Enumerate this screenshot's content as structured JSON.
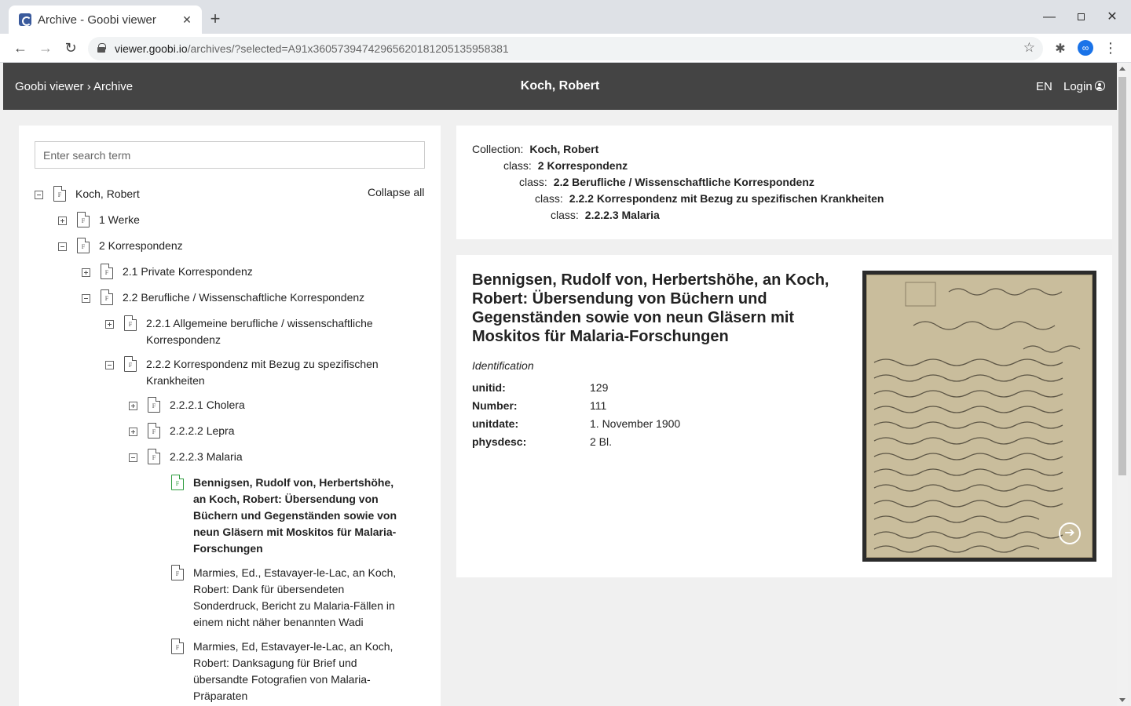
{
  "browser": {
    "tab_title": "Archive - Goobi viewer",
    "url_domain": "viewer.goobi.io",
    "url_path": "/archives/?selected=A91x36057394742965620181205135958381"
  },
  "header": {
    "breadcrumb": "Goobi viewer › Archive",
    "title": "Koch, Robert",
    "lang": "EN",
    "login": "Login"
  },
  "sidebar": {
    "search_placeholder": "Enter search term",
    "collapse_all": "Collapse all",
    "nodes": [
      {
        "label": "Koch, Robert",
        "toggle": "minus"
      },
      {
        "label": "1 Werke",
        "toggle": "plus"
      },
      {
        "label": "2 Korrespondenz",
        "toggle": "minus"
      },
      {
        "label": "2.1 Private Korrespondenz",
        "toggle": "plus"
      },
      {
        "label": "2.2 Berufliche / Wissenschaftliche Korrespondenz",
        "toggle": "minus"
      },
      {
        "label": "2.2.1 Allgemeine berufliche / wissenschaftliche Korrespondenz",
        "toggle": "plus"
      },
      {
        "label": "2.2.2 Korrespondenz mit Bezug zu spezifischen Krankheiten",
        "toggle": "minus"
      },
      {
        "label": "2.2.2.1 Cholera",
        "toggle": "plus"
      },
      {
        "label": "2.2.2.2 Lepra",
        "toggle": "plus"
      },
      {
        "label": "2.2.2.3 Malaria",
        "toggle": "minus"
      },
      {
        "label": "Bennigsen, Rudolf von, Herbertshöhe, an Koch, Robert: Übersendung von Büchern und Gegenständen sowie von neun Gläsern mit Moskitos für Malaria-Forschungen",
        "toggle": "",
        "selected": true
      },
      {
        "label": "Marmies, Ed., Estavayer-le-Lac, an Koch, Robert: Dank für übersendeten Sonderdruck, Bericht zu Malaria-Fällen in einem nicht näher benannten Wadi",
        "toggle": ""
      },
      {
        "label": "Marmies, Ed, Estavayer-le-Lac, an Koch, Robert: Danksagung für Brief und übersandte Fotografien von Malaria-Präparaten",
        "toggle": ""
      }
    ]
  },
  "collection": {
    "rows": [
      {
        "key": "Collection:",
        "value": "Koch, Robert"
      },
      {
        "key": "class:",
        "value": "2 Korrespondenz"
      },
      {
        "key": "class:",
        "value": "2.2 Berufliche / Wissenschaftliche Korrespondenz"
      },
      {
        "key": "class:",
        "value": "2.2.2 Korrespondenz mit Bezug zu spezifischen Krankheiten"
      },
      {
        "key": "class:",
        "value": "2.2.2.3 Malaria"
      }
    ]
  },
  "detail": {
    "title": "Bennigsen, Rudolf von, Herbertshöhe, an Koch, Robert: Übersendung von Büchern und Gegenständen sowie von neun Gläsern mit Moskitos für Malaria-Forschungen",
    "section": "Identification",
    "metadata": [
      {
        "key": "unitid:",
        "value": "129"
      },
      {
        "key": "Number:",
        "value": "111"
      },
      {
        "key": "unitdate:",
        "value": "1. November 1900"
      },
      {
        "key": "physdesc:",
        "value": "2 Bl."
      }
    ]
  }
}
